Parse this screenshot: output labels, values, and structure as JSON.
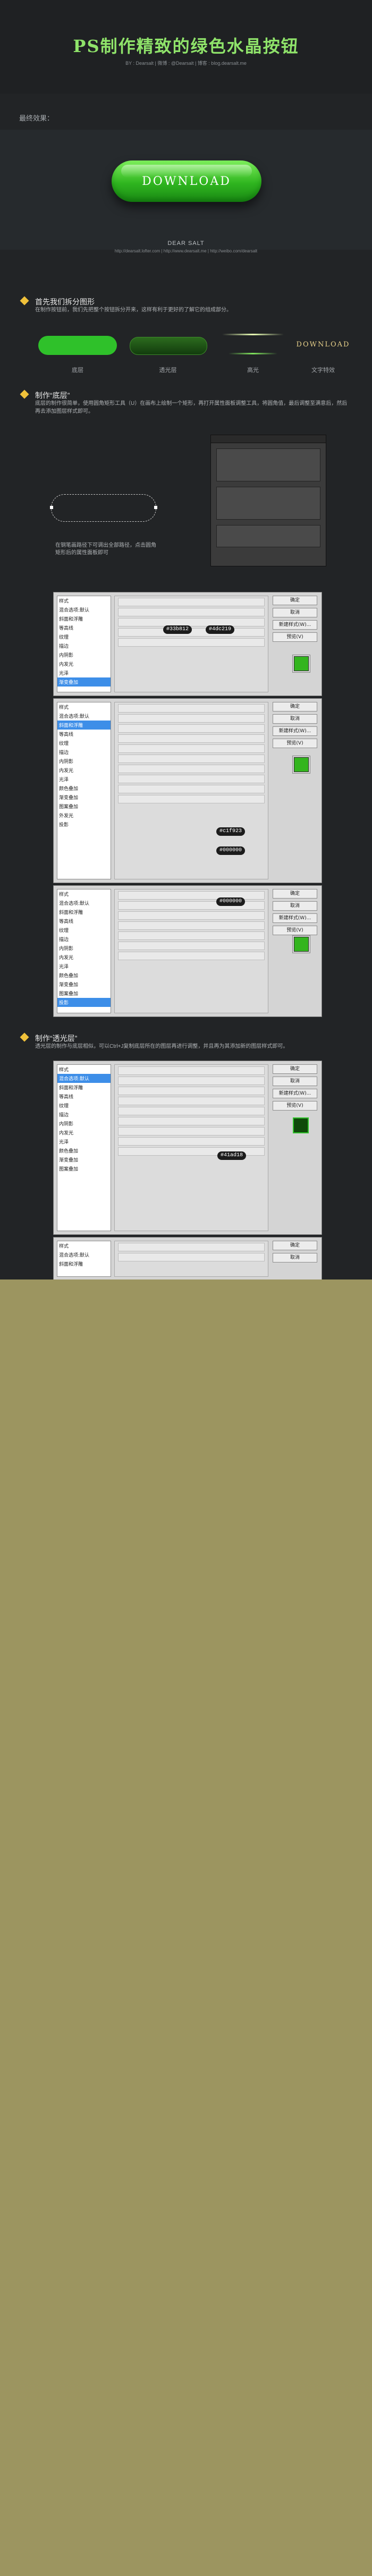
{
  "header": {
    "title": "PS制作精致的绿色水晶按钮",
    "subtitle": "BY : Dearsalt  |  微博 : @Dearsalt  |  博客 : blog.dearsalt.me"
  },
  "final_effect_label": "最终效果：",
  "download_button_label": "DOWNLOAD",
  "credit": {
    "name": "DEAR SALT",
    "links": "http://dearsalt.lofter.com  |  http://www.dearsalt.me  |  http://weibo.com/dearsalt"
  },
  "step1": {
    "title": "首先我们拆分图形",
    "desc": "在制作按钮前，我们先把整个按钮拆分开来，这样有利于更好的了解它的组成部分。",
    "highlight": "组成部分",
    "captions": [
      "底层",
      "透光层",
      "高光",
      "文字特效"
    ],
    "text_effect": "DOWNLOAD"
  },
  "step2": {
    "title": "制作“底层”",
    "desc": "底层的制作很简单，使用圆角矩形工具（U）在画布上绘制一个矩形，再打开属性面板调整工具，将圆角值，最后调整至满意后，然后再去添加图层样式即可。",
    "shape_note": "在钢笔画路径下可调出全部路径，点击圆角矩形后的属性面板即可"
  },
  "step3": {
    "title": "制作“透光层”",
    "desc": "透光层的制作与底层相似，可以Ctrl+J复制底层所在的图层再进行调整，并且再为其添加新的图层样式即可。"
  },
  "ps_panels": {
    "side_items": [
      "样式",
      "混合选项:默认",
      "斜面和浮雕",
      "等高线",
      "纹理",
      "描边",
      "内阴影",
      "内发光",
      "光泽",
      "颜色叠加",
      "渐变叠加",
      "图案叠加",
      "外发光",
      "投影"
    ],
    "buttons": [
      "确定",
      "取消",
      "新建样式(W)...",
      "预览(V)"
    ],
    "chips": [
      "#33b812",
      "#4dc219",
      "#c1f923",
      "#000000",
      "#000000",
      "#41ad18"
    ]
  },
  "colors": {
    "title_green": "#8fe36a",
    "button_green": "#33b51e",
    "accent_orange": "#f4a340",
    "bullet_yellow": "#f0c13a",
    "page_olive": "#9c9560"
  }
}
